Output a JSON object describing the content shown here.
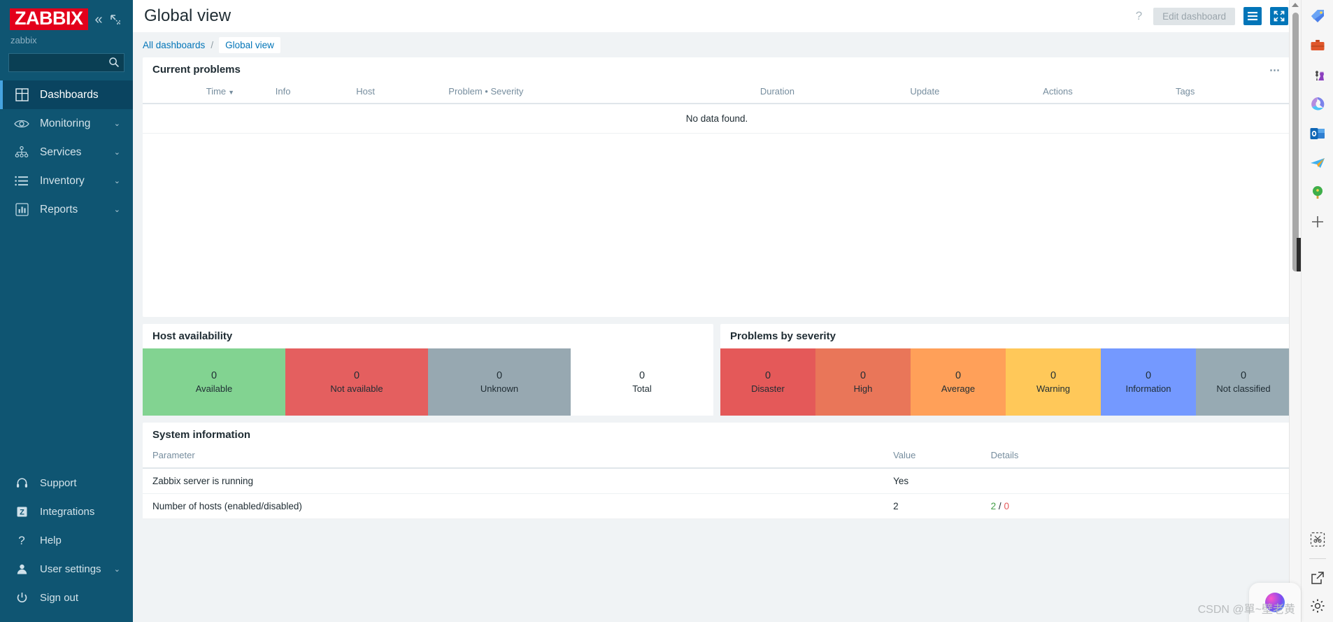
{
  "sidebar": {
    "logo_text": "ZABBIX",
    "collapse_icon": "chevrons-left-icon",
    "expand_icon": "expand-icon",
    "user_name": "zabbix",
    "search": {
      "value": "",
      "placeholder": "",
      "icon": "search-icon"
    },
    "items": [
      {
        "label": "Dashboards",
        "icon": "dashboard-grid-icon",
        "active": true,
        "chevron": ""
      },
      {
        "label": "Monitoring",
        "icon": "eye-icon",
        "active": false,
        "chevron": "⌄"
      },
      {
        "label": "Services",
        "icon": "sitemap-icon",
        "active": false,
        "chevron": "⌄"
      },
      {
        "label": "Inventory",
        "icon": "list-icon",
        "active": false,
        "chevron": "⌄"
      },
      {
        "label": "Reports",
        "icon": "bar-chart-icon",
        "active": false,
        "chevron": "⌄"
      }
    ],
    "bottom_items": [
      {
        "label": "Support",
        "icon": "headset-icon",
        "chevron": ""
      },
      {
        "label": "Integrations",
        "icon": "zabbix-z-icon",
        "chevron": ""
      },
      {
        "label": "Help",
        "icon": "question-icon",
        "chevron": ""
      },
      {
        "label": "User settings",
        "icon": "user-icon",
        "chevron": "⌄"
      },
      {
        "label": "Sign out",
        "icon": "power-icon",
        "chevron": ""
      }
    ]
  },
  "header": {
    "title": "Global view",
    "help_label": "?",
    "edit_dashboard_label": "Edit dashboard",
    "menu_icon": "hamburger-icon",
    "fullscreen_icon": "fullscreen-icon"
  },
  "breadcrumb": {
    "all_dashboards": "All dashboards",
    "separator": "/",
    "current": "Global view"
  },
  "widgets": {
    "current_problems": {
      "title": "Current problems",
      "menu_icon": "ellipsis-icon",
      "columns": [
        "Time",
        "Info",
        "Host",
        "Problem • Severity",
        "Duration",
        "Update",
        "Actions",
        "Tags"
      ],
      "sort_column": "Time",
      "sort_direction": "desc",
      "empty_message": "No data found.",
      "rows": []
    },
    "host_availability": {
      "title": "Host availability",
      "cells": [
        {
          "value": "0",
          "label": "Available",
          "color": "#82d391",
          "text_color": "#1f2c33"
        },
        {
          "value": "0",
          "label": "Not available",
          "color": "#e45f5f",
          "text_color": "#1f2c33"
        },
        {
          "value": "0",
          "label": "Unknown",
          "color": "#97a8b1",
          "text_color": "#1f2c33"
        },
        {
          "value": "0",
          "label": "Total",
          "color": "#ffffff",
          "text_color": "#1f2c33"
        }
      ]
    },
    "problems_by_severity": {
      "title": "Problems by severity",
      "cells": [
        {
          "value": "0",
          "label": "Disaster",
          "color": "#e45959",
          "text_color": "#1f2c33"
        },
        {
          "value": "0",
          "label": "High",
          "color": "#e97659",
          "text_color": "#1f2c33"
        },
        {
          "value": "0",
          "label": "Average",
          "color": "#ffa059",
          "text_color": "#1f2c33"
        },
        {
          "value": "0",
          "label": "Warning",
          "color": "#ffc859",
          "text_color": "#1f2c33"
        },
        {
          "value": "0",
          "label": "Information",
          "color": "#7499ff",
          "text_color": "#1f2c33"
        },
        {
          "value": "0",
          "label": "Not classified",
          "color": "#97aab3",
          "text_color": "#1f2c33"
        }
      ]
    },
    "system_information": {
      "title": "System information",
      "columns": [
        "Parameter",
        "Value",
        "Details"
      ],
      "rows": [
        {
          "parameter": "Zabbix server is running",
          "value": "Yes",
          "value_color": "#429e47",
          "details_ok": "",
          "details_sep": "",
          "details_bad": ""
        },
        {
          "parameter": "Number of hosts (enabled/disabled)",
          "value": "2",
          "value_color": "#1f2c33",
          "details_ok": "2",
          "details_sep": " / ",
          "details_bad": "0"
        }
      ]
    }
  },
  "browser_rail": {
    "icons": [
      "tag-icon",
      "briefcase-icon",
      "chess-icon",
      "microsoft-365-icon",
      "outlook-icon",
      "telegram-icon",
      "tree-icon",
      "plus-icon"
    ],
    "bottom_icons": [
      "screenshot-icon",
      "open-external-icon",
      "settings-gear-icon"
    ]
  },
  "overlay": {
    "watermark": "CSDN @單~壁老黄",
    "copilot_icon": "copilot-icon"
  }
}
